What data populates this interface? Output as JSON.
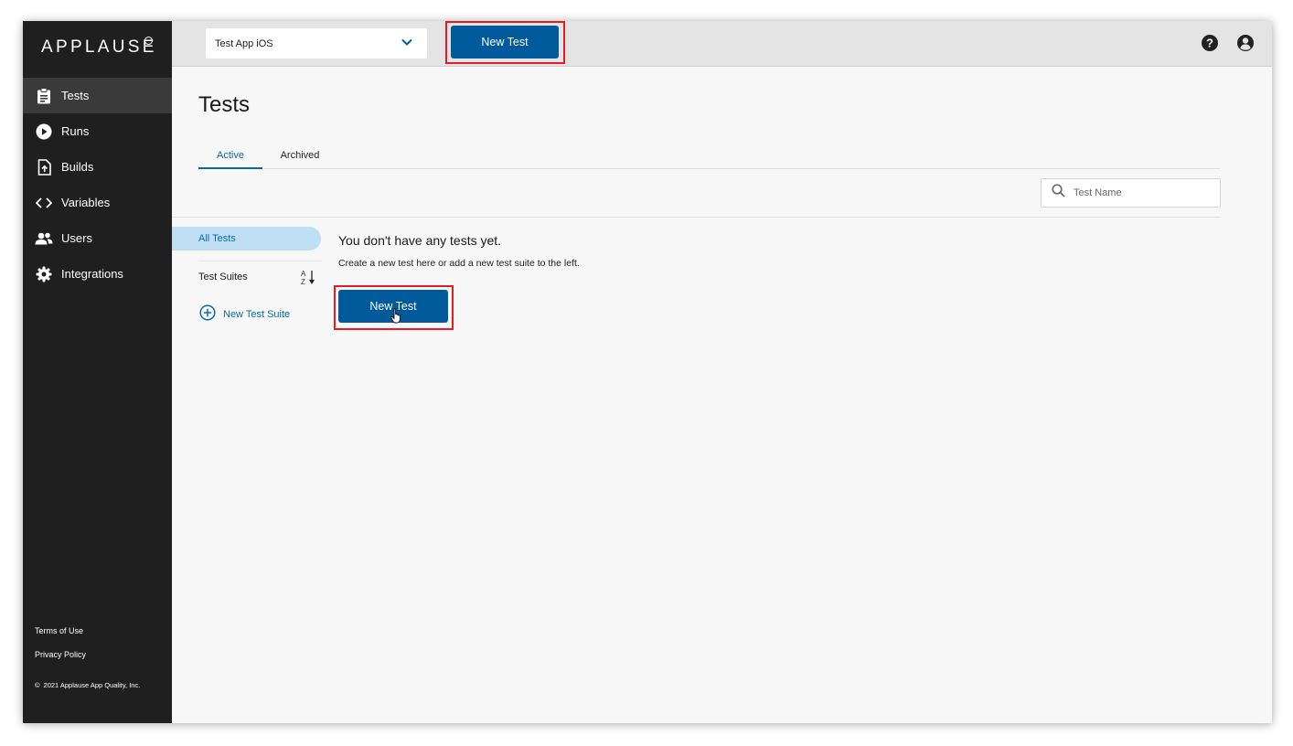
{
  "sidebar": {
    "logo": "APPLAUSE",
    "items": [
      {
        "label": "Tests",
        "icon": "clipboard-icon",
        "active": true
      },
      {
        "label": "Runs",
        "icon": "play-circle-icon",
        "active": false
      },
      {
        "label": "Builds",
        "icon": "file-upload-icon",
        "active": false
      },
      {
        "label": "Variables",
        "icon": "code-brackets-icon",
        "active": false
      },
      {
        "label": "Users",
        "icon": "users-icon",
        "active": false
      },
      {
        "label": "Integrations",
        "icon": "gear-icon",
        "active": false
      }
    ],
    "footer": {
      "terms": "Terms of Use",
      "privacy": "Privacy Policy",
      "copyright": "2021 Applause App Quality, Inc."
    }
  },
  "topbar": {
    "app_select_value": "Test App iOS",
    "new_test_label": "New Test"
  },
  "main": {
    "title": "Tests",
    "tabs": [
      {
        "label": "Active",
        "active": true
      },
      {
        "label": "Archived",
        "active": false
      }
    ],
    "search_placeholder": "Test Name",
    "suites": {
      "all_tests": "All Tests",
      "label": "Test Suites",
      "new_suite": "New Test Suite"
    },
    "empty": {
      "title": "You don't have any tests yet.",
      "subtitle": "Create a new test here or add a new test suite to the left.",
      "button": "New Test"
    }
  },
  "colors": {
    "primary": "#005a9c",
    "link": "#0a6aa8",
    "sidebar_bg": "#1f1f1f",
    "highlight": "#e41d24",
    "selected_bg": "#bee0f2"
  }
}
